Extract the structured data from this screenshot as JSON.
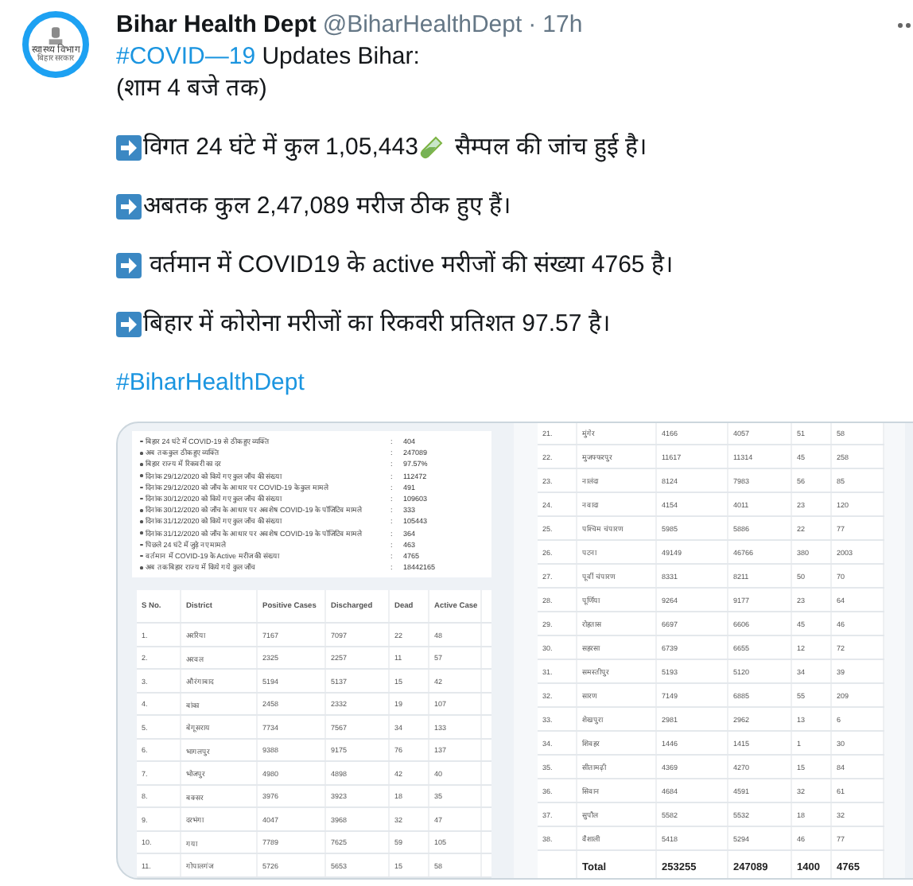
{
  "tweet": {
    "avatar": {
      "title": "स्वास्थ्य विभाग",
      "subtitle": "बिहार सरकार"
    },
    "author": "Bihar Health Dept",
    "handle": "@BiharHealthDept",
    "separator": "·",
    "time": "17h",
    "intro": {
      "hashtag": "#COVID—19",
      "text": " Updates Bihar:",
      "line2": "(शाम 4 बजे तक)"
    },
    "bullets": [
      {
        "kind": "test",
        "before": "विगत 24 घंटे में कुल 1,05,443",
        "after": " सैम्पल की जांच हुई है।"
      },
      {
        "kind": "plain",
        "before": "अबतक कुल 2,47,089 मरीज ठीक हुए हैं।"
      },
      {
        "kind": "plain",
        "before": " वर्तमान में COVID19 के active मरीजों की संख्या 4765 है।"
      },
      {
        "kind": "plain",
        "before": "बिहार में कोरोना मरीजों का रिकवरी प्रतिशत 97.57 है।"
      }
    ],
    "hashtag": "#BiharHealthDept"
  },
  "image": {
    "summary": [
      {
        "label": "बिहार 24 घंटे में COVID-19 से ठीक हुए व्यक्ति",
        "sep": ":",
        "value": "404"
      },
      {
        "label": "अब तक कुल ठीक हुए व्यक्ति",
        "sep": ":",
        "value": "247089"
      },
      {
        "label": "बिहार राज्य में रिकवरी का दर",
        "sep": ":",
        "value": "97.57%"
      },
      {
        "label": "दिनांक 29/12/2020 को किये गए कुल जाँच की संख्या",
        "sep": ":",
        "value": "112472"
      },
      {
        "label": "दिनांक 29/12/2020 को जाँच के आधार पर COVID-19 के कुल मामले",
        "sep": ":",
        "value": "491"
      },
      {
        "label": "दिनांक 30/12/2020 को किये गए कुल जाँच की संख्या",
        "sep": ":",
        "value": "109603"
      },
      {
        "label": "दिनांक 30/12/2020 को जाँच के आधार पर अवशेष COVID-19 के पॉजिटिव मामले",
        "sep": ":",
        "value": "333"
      },
      {
        "label": "दिनांक 31/12/2020 को किये गए कुल जाँच की संख्या",
        "sep": ":",
        "value": "105443"
      },
      {
        "label": "दिनांक 31/12/2020 को जाँच के आधार पर अवशेष COVID-19 के पॉजिटिव मामले",
        "sep": ":",
        "value": "364"
      },
      {
        "label": "पिछले 24 घंटे में जुड़े नए मामले",
        "sep": ":",
        "value": "463"
      },
      {
        "label": "वर्तमान में COVID-19 के Active मरीज की संख्या",
        "sep": ":",
        "value": "4765"
      },
      {
        "label": "अब तक बिहार राज्य में किये गये कुल जाँच",
        "sep": ":",
        "value": "18442165"
      }
    ],
    "left_table": {
      "columns": [
        "S No.",
        "District",
        "Positive Cases",
        "Discharged",
        "Dead",
        "Active Case"
      ],
      "rows": [
        [
          "1.",
          "अररिया",
          "7167",
          "7097",
          "22",
          "48"
        ],
        [
          "2.",
          "अरवल",
          "2325",
          "2257",
          "11",
          "57"
        ],
        [
          "3.",
          "औरंगाबाद",
          "5194",
          "5137",
          "15",
          "42"
        ],
        [
          "4.",
          "बांका",
          "2458",
          "2332",
          "19",
          "107"
        ],
        [
          "5.",
          "बेगूसराय",
          "7734",
          "7567",
          "34",
          "133"
        ],
        [
          "6.",
          "भागलपुर",
          "9388",
          "9175",
          "76",
          "137"
        ],
        [
          "7.",
          "भोजपुर",
          "4980",
          "4898",
          "42",
          "40"
        ],
        [
          "8.",
          "बक्सर",
          "3976",
          "3923",
          "18",
          "35"
        ],
        [
          "9.",
          "दरभंगा",
          "4047",
          "3968",
          "32",
          "47"
        ],
        [
          "10.",
          "गया",
          "7789",
          "7625",
          "59",
          "105"
        ],
        [
          "11.",
          "गोपालगंज",
          "5726",
          "5653",
          "15",
          "58"
        ]
      ]
    },
    "right_table": {
      "rows": [
        [
          "21.",
          "मुंगेर",
          "4166",
          "4057",
          "51",
          "58"
        ],
        [
          "22.",
          "मुजफ्फरपुर",
          "11617",
          "11314",
          "45",
          "258"
        ],
        [
          "23.",
          "नालंदा",
          "8124",
          "7983",
          "56",
          "85"
        ],
        [
          "24.",
          "नवादा",
          "4154",
          "4011",
          "23",
          "120"
        ],
        [
          "25.",
          "पश्चिम चंपारण",
          "5985",
          "5886",
          "22",
          "77"
        ],
        [
          "26.",
          "पटना",
          "49149",
          "46766",
          "380",
          "2003"
        ],
        [
          "27.",
          "पूर्वी चंपारण",
          "8331",
          "8211",
          "50",
          "70"
        ],
        [
          "28.",
          "पूर्णिया",
          "9264",
          "9177",
          "23",
          "64"
        ],
        [
          "29.",
          "रोहतास",
          "6697",
          "6606",
          "45",
          "46"
        ],
        [
          "30.",
          "सहरसा",
          "6739",
          "6655",
          "12",
          "72"
        ],
        [
          "31.",
          "समस्तीपुर",
          "5193",
          "5120",
          "34",
          "39"
        ],
        [
          "32.",
          "सारण",
          "7149",
          "6885",
          "55",
          "209"
        ],
        [
          "33.",
          "शेखपुरा",
          "2981",
          "2962",
          "13",
          "6"
        ],
        [
          "34.",
          "शिवहर",
          "1446",
          "1415",
          "1",
          "30"
        ],
        [
          "35.",
          "सीतामढ़ी",
          "4369",
          "4270",
          "15",
          "84"
        ],
        [
          "36.",
          "सिवान",
          "4684",
          "4591",
          "32",
          "61"
        ],
        [
          "37.",
          "सुपौल",
          "5582",
          "5532",
          "18",
          "32"
        ],
        [
          "38.",
          "वैशाली",
          "5418",
          "5294",
          "46",
          "77"
        ]
      ],
      "total": [
        "Total",
        "253255",
        "247089",
        "1400",
        "4765"
      ]
    }
  }
}
